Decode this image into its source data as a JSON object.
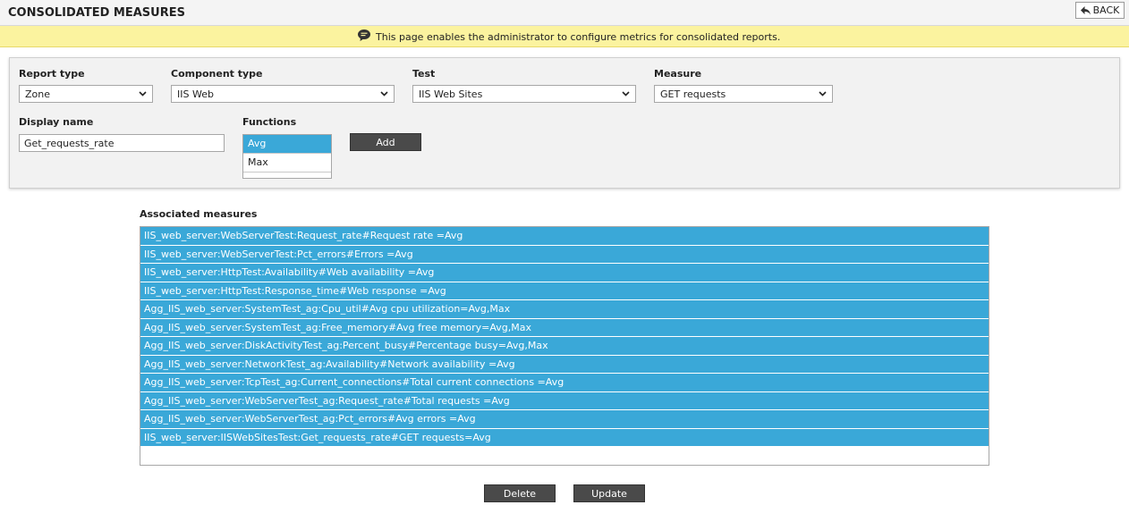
{
  "header": {
    "title": "CONSOLIDATED MEASURES",
    "back_label": "BACK"
  },
  "info": {
    "text": "This page enables the administrator to configure metrics for consolidated reports."
  },
  "form": {
    "report_type": {
      "label": "Report type",
      "value": "Zone"
    },
    "component_type": {
      "label": "Component type",
      "value": "IIS Web"
    },
    "test": {
      "label": "Test",
      "value": "IIS Web Sites"
    },
    "measure": {
      "label": "Measure",
      "value": "GET requests"
    },
    "display_name": {
      "label": "Display name",
      "value": "Get_requests_rate"
    },
    "functions": {
      "label": "Functions",
      "options": [
        "Avg",
        "Max"
      ],
      "selected": "Avg"
    },
    "add_label": "Add"
  },
  "associated": {
    "label": "Associated measures",
    "items": [
      "IIS_web_server:WebServerTest:Request_rate#Request rate =Avg",
      "IIS_web_server:WebServerTest:Pct_errors#Errors =Avg",
      "IIS_web_server:HttpTest:Availability#Web availability =Avg",
      "IIS_web_server:HttpTest:Response_time#Web response =Avg",
      "Agg_IIS_web_server:SystemTest_ag:Cpu_util#Avg cpu utilization=Avg,Max",
      "Agg_IIS_web_server:SystemTest_ag:Free_memory#Avg free memory=Avg,Max",
      "Agg_IIS_web_server:DiskActivityTest_ag:Percent_busy#Percentage busy=Avg,Max",
      "Agg_IIS_web_server:NetworkTest_ag:Availability#Network availability =Avg",
      "Agg_IIS_web_server:TcpTest_ag:Current_connections#Total current connections =Avg",
      "Agg_IIS_web_server:WebServerTest_ag:Request_rate#Total requests =Avg",
      "Agg_IIS_web_server:WebServerTest_ag:Pct_errors#Avg errors =Avg",
      "IIS_web_server:IISWebSitesTest:Get_requests_rate#GET requests=Avg"
    ]
  },
  "actions": {
    "delete_label": "Delete",
    "update_label": "Update"
  },
  "colors": {
    "selected_blue": "#3aa8d8",
    "info_yellow": "#fbf39f",
    "button_dark": "#4a4a4a"
  }
}
